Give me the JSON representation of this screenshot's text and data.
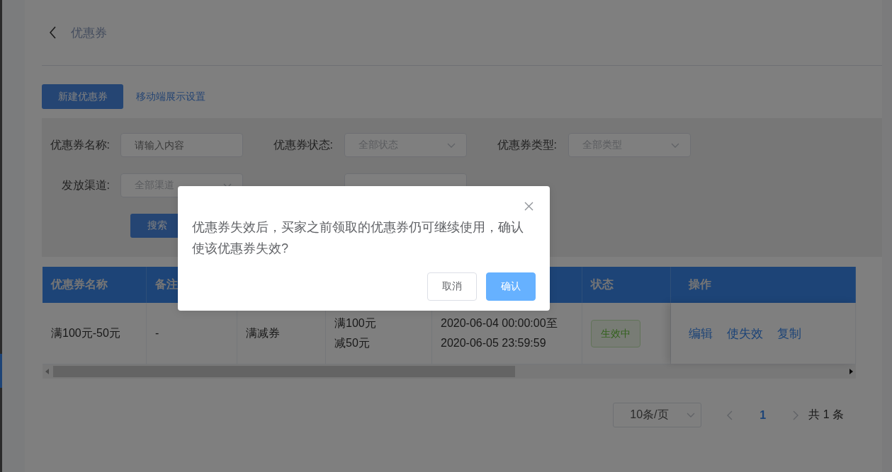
{
  "page": {
    "title": "优惠券"
  },
  "toolbar": {
    "primary_button": "新建优惠券",
    "link": "移动端展示设置"
  },
  "filters": [
    {
      "kind": "input",
      "label": "优惠券名称:",
      "placeholder": "请输入内容"
    },
    {
      "kind": "select",
      "label": "优惠券状态:",
      "placeholder": "全部状态"
    },
    {
      "kind": "select",
      "label": "优惠券类型:",
      "placeholder": "全部类型"
    },
    {
      "kind": "select",
      "label": "发放渠道:",
      "placeholder": "全部渠道"
    },
    {
      "kind": "input"
    }
  ],
  "search_button": "搜索",
  "table": {
    "columns": [
      "优惠券名称",
      "备注",
      null,
      null,
      null,
      "状态",
      "操作"
    ],
    "rows": [
      {
        "cells": [
          [
            "满100元-50元"
          ],
          [
            "-"
          ],
          [
            "满减券"
          ],
          [
            "满100元",
            "减50元"
          ],
          [
            "2020-06-04 00:00:00至",
            "2020-06-05 23:59:59"
          ]
        ],
        "status": "生效中",
        "actions": [
          "编辑",
          "使失效",
          "复制"
        ]
      }
    ]
  },
  "pagination": {
    "page_size": "10条/页",
    "pages": [
      {
        "label": "1",
        "selected": true
      }
    ],
    "total": "共 1 条"
  },
  "dialog": {
    "message": "优惠券失效后，买家之前领取的优惠券仍可继续使用，确认使该优惠券失效?",
    "buttons": [
      {
        "label": "取消",
        "kind": "default"
      },
      {
        "label": "确认",
        "kind": "primary"
      }
    ]
  }
}
